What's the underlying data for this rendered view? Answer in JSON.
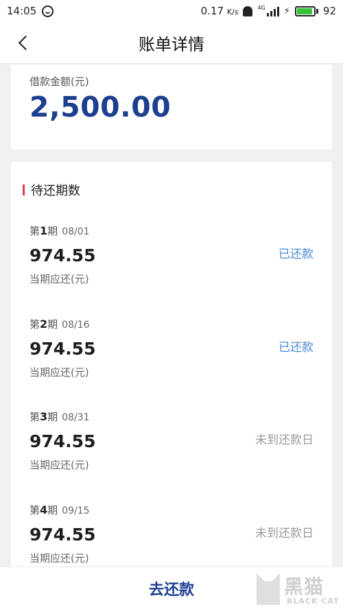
{
  "status_bar": {
    "time": "14:05",
    "net_speed": "0.17",
    "net_unit": "K/s",
    "network_type": "4G",
    "battery": "92",
    "battery_level": 0.92,
    "icons": [
      "face-icon",
      "ghost-icon",
      "signal-icon",
      "charging-icon",
      "battery-icon"
    ]
  },
  "header": {
    "title": "账单详情"
  },
  "loan": {
    "label": "借款金额(元)",
    "amount": "2,500.00"
  },
  "installments": {
    "title": "待还期数",
    "items": [
      {
        "prefix": "第",
        "num": "1",
        "suffix": "期",
        "date": "08/01",
        "amount": "974.55",
        "sub": "当期应还(元)",
        "status": "已还款",
        "status_type": "paid"
      },
      {
        "prefix": "第",
        "num": "2",
        "suffix": "期",
        "date": "08/16",
        "amount": "974.55",
        "sub": "当期应还(元)",
        "status": "已还款",
        "status_type": "paid"
      },
      {
        "prefix": "第",
        "num": "3",
        "suffix": "期",
        "date": "08/31",
        "amount": "974.55",
        "sub": "当期应还(元)",
        "status": "未到还款日",
        "status_type": "not_due"
      },
      {
        "prefix": "第",
        "num": "4",
        "suffix": "期",
        "date": "09/15",
        "amount": "974.55",
        "sub": "当期应还(元)",
        "status": "未到还款日",
        "status_type": "not_due"
      }
    ]
  },
  "footer": {
    "repay_label": "去还款"
  },
  "watermark": {
    "cn": "黑猫",
    "en": "BLACK CAT"
  },
  "colors": {
    "amount_blue": "#1c3f8f",
    "accent_red": "#e2384a",
    "paid_blue": "#4a8bd6",
    "not_due_gray": "#9a9a9a",
    "battery_green": "#37c23c"
  }
}
